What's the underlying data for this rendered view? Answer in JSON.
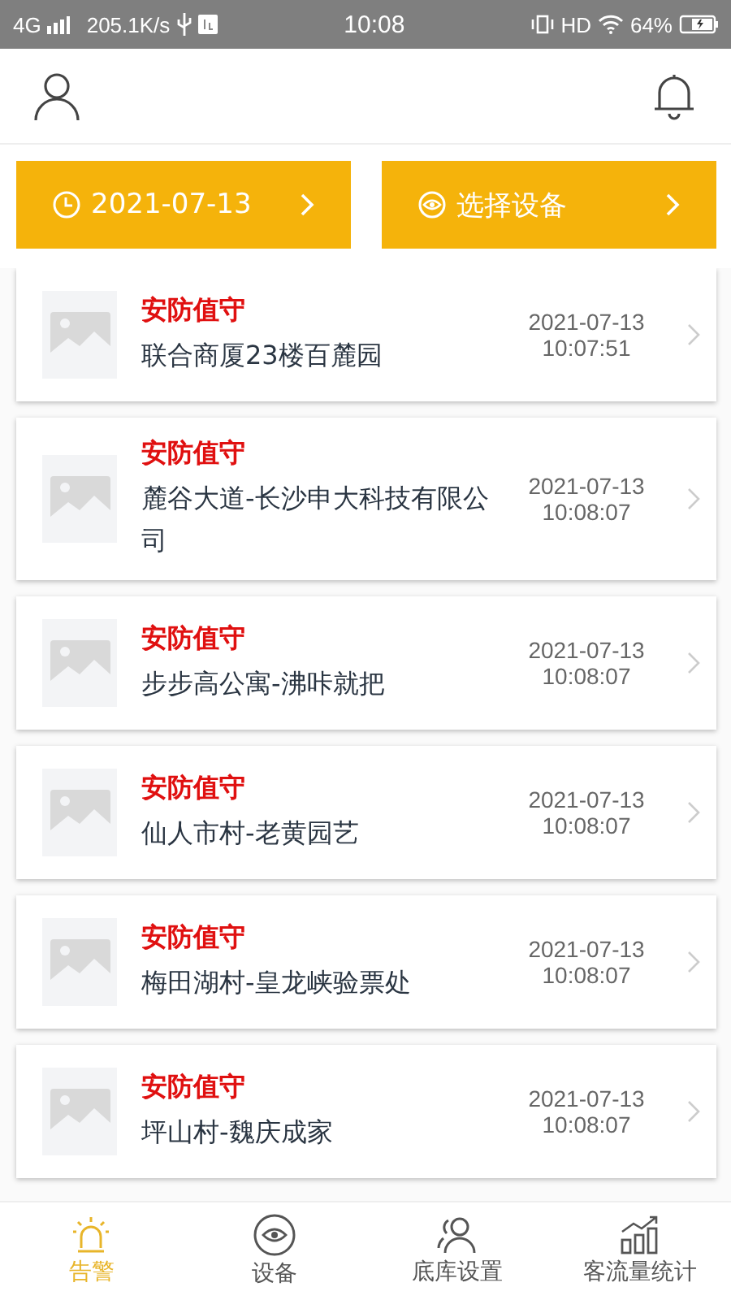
{
  "status_bar": {
    "network": "4G",
    "speed": "205.1K/s",
    "time": "10:08",
    "hd": "HD",
    "battery": "64%"
  },
  "filters": [
    {
      "kind": "date",
      "label": "2021-07-13"
    },
    {
      "kind": "device",
      "label": "选择设备"
    }
  ],
  "alarms": [
    {
      "type": "安防值守",
      "place": "联合商厦23楼百麓园",
      "date": "2021-07-13",
      "time": "10:07:51"
    },
    {
      "type": "安防值守",
      "place": "麓谷大道-长沙申大科技有限公司",
      "date": "2021-07-13",
      "time": "10:08:07"
    },
    {
      "type": "安防值守",
      "place": "步步高公寓-沸咔就把",
      "date": "2021-07-13",
      "time": "10:08:07"
    },
    {
      "type": "安防值守",
      "place": "仙人市村-老黄园艺",
      "date": "2021-07-13",
      "time": "10:08:07"
    },
    {
      "type": "安防值守",
      "place": "梅田湖村-皇龙峡验票处",
      "date": "2021-07-13",
      "time": "10:08:07"
    },
    {
      "type": "安防值守",
      "place": "坪山村-魏庆成家",
      "date": "2021-07-13",
      "time": "10:08:07"
    }
  ],
  "tabs": [
    {
      "kind": "alarm",
      "label": "告警",
      "selected": true
    },
    {
      "kind": "device",
      "label": "设备",
      "selected": false
    },
    {
      "kind": "people",
      "label": "底库设置",
      "selected": false
    },
    {
      "kind": "stats",
      "label": "客流量统计",
      "selected": false
    }
  ]
}
